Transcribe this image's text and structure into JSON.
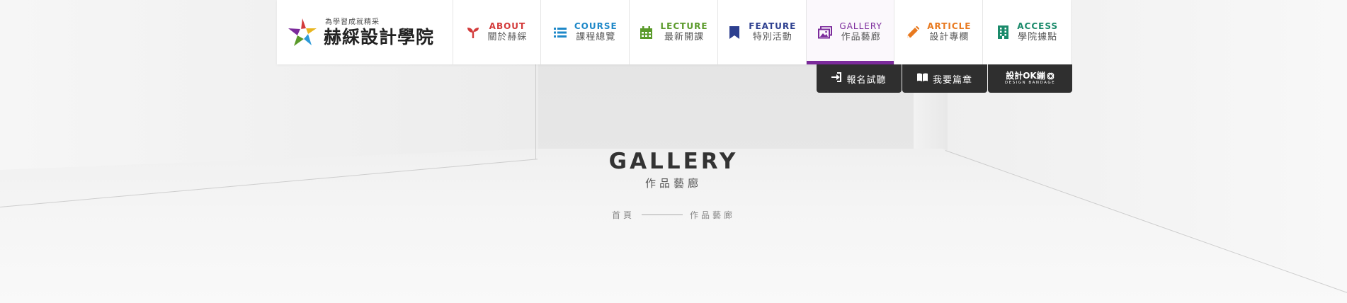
{
  "brand": {
    "tagline": "為學習成就精采",
    "name": "赫綵設計學院"
  },
  "nav": [
    {
      "en": "ABOUT",
      "zh": "關於赫綵",
      "color": "#d33a3a",
      "icon": "sprout-icon"
    },
    {
      "en": "COURSE",
      "zh": "課程總覽",
      "color": "#1e88c8",
      "icon": "list-icon"
    },
    {
      "en": "LECTURE",
      "zh": "最新開課",
      "color": "#5a9a2a",
      "icon": "calendar-icon"
    },
    {
      "en": "FEATURE",
      "zh": "特別活動",
      "color": "#2d3f8f",
      "icon": "bookmark-icon"
    },
    {
      "en": "GALLERY",
      "zh": "作品藝廊",
      "color": "#7b2a9b",
      "icon": "images-icon",
      "active": true
    },
    {
      "en": "ARTICLE",
      "zh": "設計專欄",
      "color": "#e8791f",
      "icon": "pencil-icon"
    },
    {
      "en": "ACCESS",
      "zh": "學院據點",
      "color": "#1a8a6a",
      "icon": "building-icon"
    }
  ],
  "subnav": {
    "signup": "報名試聽",
    "chapter": "我要篇章",
    "ok_top": "設計OK繃",
    "ok_bottom": "DESIGN BANDAGE"
  },
  "hero": {
    "title": "GALLERY",
    "subtitle": "作品藝廊"
  },
  "breadcrumb": {
    "home": "首頁",
    "current": "作品藝廊"
  }
}
